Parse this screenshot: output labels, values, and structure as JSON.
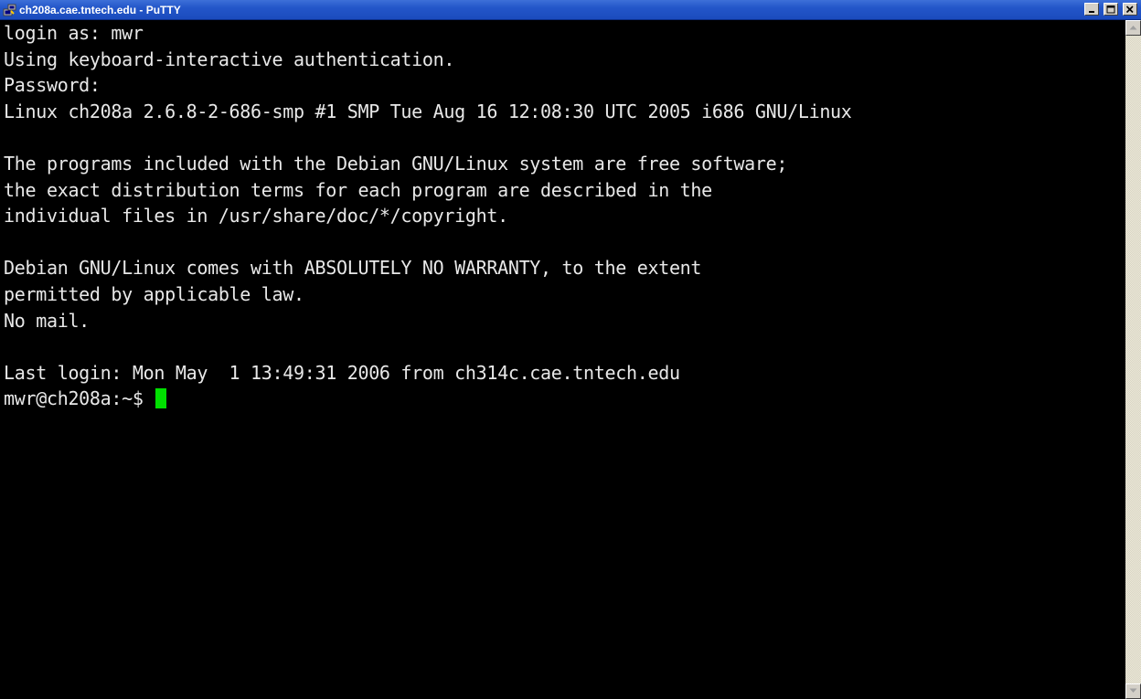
{
  "window": {
    "title": "ch208a.cae.tntech.edu - PuTTY",
    "icon": "putty-icon",
    "controls": [
      "minimize-icon",
      "maximize-icon",
      "close-icon"
    ]
  },
  "terminal": {
    "lines": [
      "login as: mwr",
      "Using keyboard-interactive authentication.",
      "Password:",
      "Linux ch208a 2.6.8-2-686-smp #1 SMP Tue Aug 16 12:08:30 UTC 2005 i686 GNU/Linux",
      "",
      "The programs included with the Debian GNU/Linux system are free software;",
      "the exact distribution terms for each program are described in the",
      "individual files in /usr/share/doc/*/copyright.",
      "",
      "Debian GNU/Linux comes with ABSOLUTELY NO WARRANTY, to the extent",
      "permitted by applicable law.",
      "No mail.",
      "",
      "Last login: Mon May  1 13:49:31 2006 from ch314c.cae.tntech.edu"
    ],
    "prompt": "mwr@ch208a:~$ ",
    "cursor_color": "#00e000",
    "text_color": "#e8e8e8",
    "background": "#000000"
  },
  "scrollbar": {
    "up_icon": "scroll-up-arrow-icon",
    "down_icon": "scroll-down-arrow-icon"
  }
}
